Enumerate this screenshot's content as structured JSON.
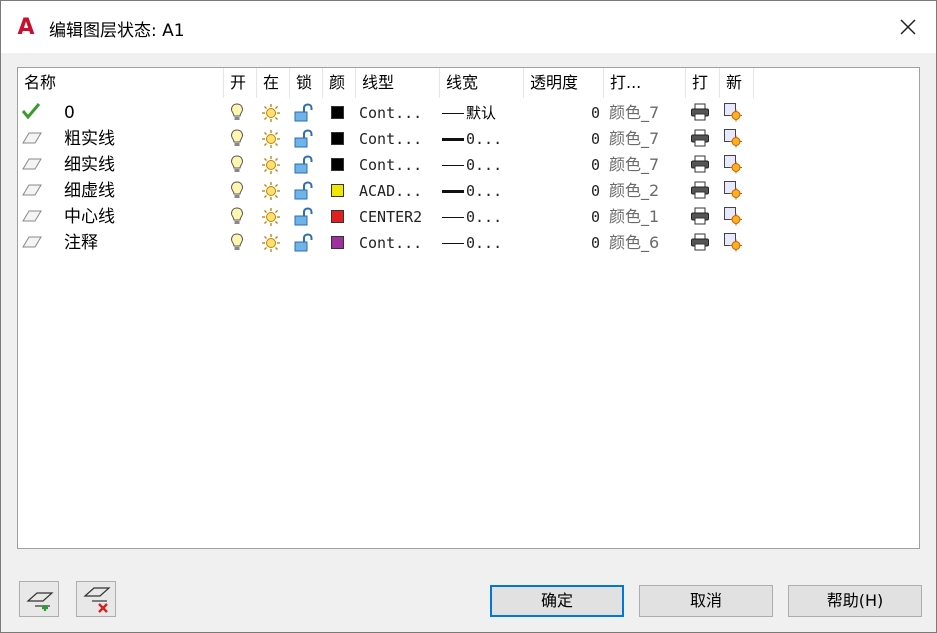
{
  "window": {
    "title": "编辑图层状态: A1",
    "app_logo_letter": "A"
  },
  "columns": [
    "名称",
    "开",
    "在",
    "锁",
    "颜",
    "线型",
    "线宽",
    "透明度",
    "打...",
    "打",
    "新"
  ],
  "layers": [
    {
      "name": "0",
      "current": true,
      "color": "#000000",
      "linetype": "Cont...",
      "lineweight": "默认",
      "lw_thick": false,
      "transparency": "0",
      "plot_style": "颜色_7"
    },
    {
      "name": "粗实线",
      "current": false,
      "color": "#000000",
      "linetype": "Cont...",
      "lineweight": "0...",
      "lw_thick": true,
      "transparency": "0",
      "plot_style": "颜色_7"
    },
    {
      "name": "细实线",
      "current": false,
      "color": "#000000",
      "linetype": "Cont...",
      "lineweight": "0...",
      "lw_thick": false,
      "transparency": "0",
      "plot_style": "颜色_7"
    },
    {
      "name": "细虚线",
      "current": false,
      "color": "#f2e600",
      "linetype": "ACAD...",
      "lineweight": "0...",
      "lw_thick": true,
      "transparency": "0",
      "plot_style": "颜色_2"
    },
    {
      "name": "中心线",
      "current": false,
      "color": "#e02020",
      "linetype": "CENTER2",
      "lineweight": "0...",
      "lw_thick": false,
      "transparency": "0",
      "plot_style": "颜色_1"
    },
    {
      "name": "注释",
      "current": false,
      "color": "#a030a0",
      "linetype": "Cont...",
      "lineweight": "0...",
      "lw_thick": false,
      "transparency": "0",
      "plot_style": "颜色_6"
    }
  ],
  "buttons": {
    "ok": "确定",
    "cancel": "取消",
    "help": "帮助(H)"
  }
}
